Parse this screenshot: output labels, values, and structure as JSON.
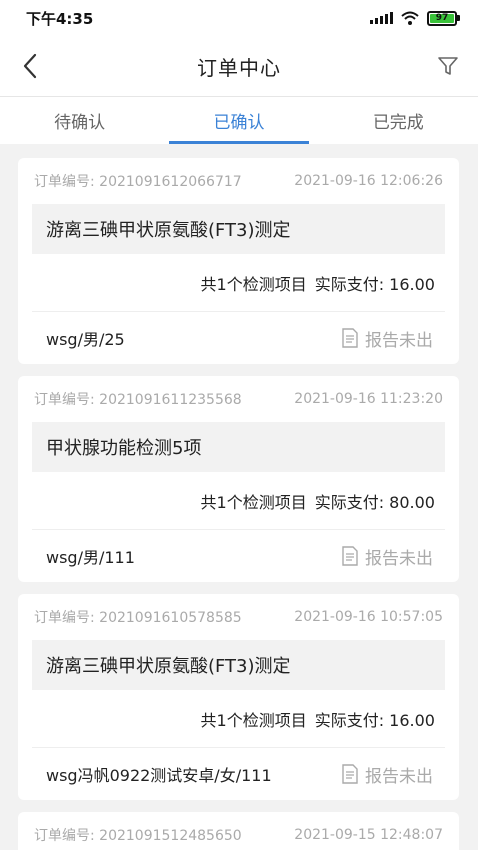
{
  "status_bar": {
    "time": "下午4:35",
    "battery": "97",
    "icons": [
      "signal-icon",
      "wifi-icon",
      "battery-icon"
    ]
  },
  "nav": {
    "title": "订单中心",
    "back_icon": "chevron-left-icon",
    "filter_icon": "filter-icon"
  },
  "tabs": [
    {
      "label": "待确认",
      "active": false
    },
    {
      "label": "已确认",
      "active": true
    },
    {
      "label": "已完成",
      "active": false
    }
  ],
  "orders": [
    {
      "order_no": "订单编号: 2021091612066717",
      "time": "2021-09-16 12:06:26",
      "item_name": "游离三碘甲状原氨酸(FT3)测定",
      "item_count": "共1个检测项目",
      "paid": "实际支付: 16.00",
      "patient": "wsg/男/25",
      "report_status": "报告未出"
    },
    {
      "order_no": "订单编号: 2021091611235568",
      "time": "2021-09-16 11:23:20",
      "item_name": "甲状腺功能检测5项",
      "item_count": "共1个检测项目",
      "paid": "实际支付: 80.00",
      "patient": "wsg/男/111",
      "report_status": "报告未出"
    },
    {
      "order_no": "订单编号: 2021091610578585",
      "time": "2021-09-16 10:57:05",
      "item_name": "游离三碘甲状原氨酸(FT3)测定",
      "item_count": "共1个检测项目",
      "paid": "实际支付: 16.00",
      "patient": "wsg冯帆0922测试安卓/女/111",
      "report_status": "报告未出"
    },
    {
      "order_no": "订单编号: 2021091512485650",
      "time": "2021-09-15 12:48:07"
    }
  ],
  "colors": {
    "accent": "#3b82d6",
    "background": "#f2f2f2",
    "muted_text": "#aaaaaa"
  }
}
